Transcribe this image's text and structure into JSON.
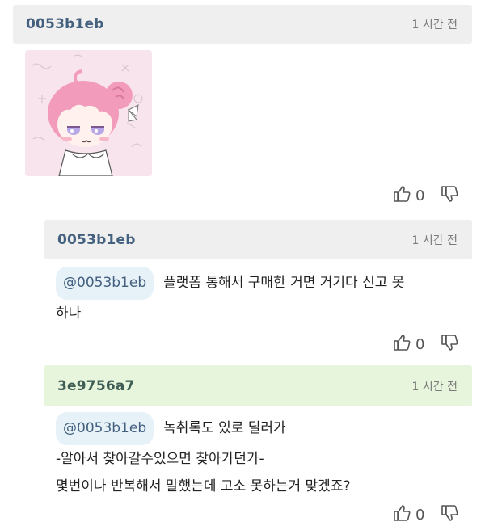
{
  "comments": [
    {
      "author": "0053b1eb",
      "time": "1 시간 전",
      "likes": "0"
    },
    {
      "author": "0053b1eb",
      "time": "1 시간 전",
      "mention": "@0053b1eb",
      "lines": [
        "플랫폼 통해서 구매한 거면 거기다 신고 못",
        "하나"
      ],
      "likes": "0"
    },
    {
      "author": "3e9756a7",
      "time": "1 시간 전",
      "mention": "@0053b1eb",
      "lines": [
        "녹취록도 있로 딜러가",
        "-알아서 찾아갈수있으면 찾아가던가-",
        "몇번이나 반복해서 말했는데 고소 못하는거 맞겠죠?"
      ],
      "likes": "0"
    }
  ]
}
